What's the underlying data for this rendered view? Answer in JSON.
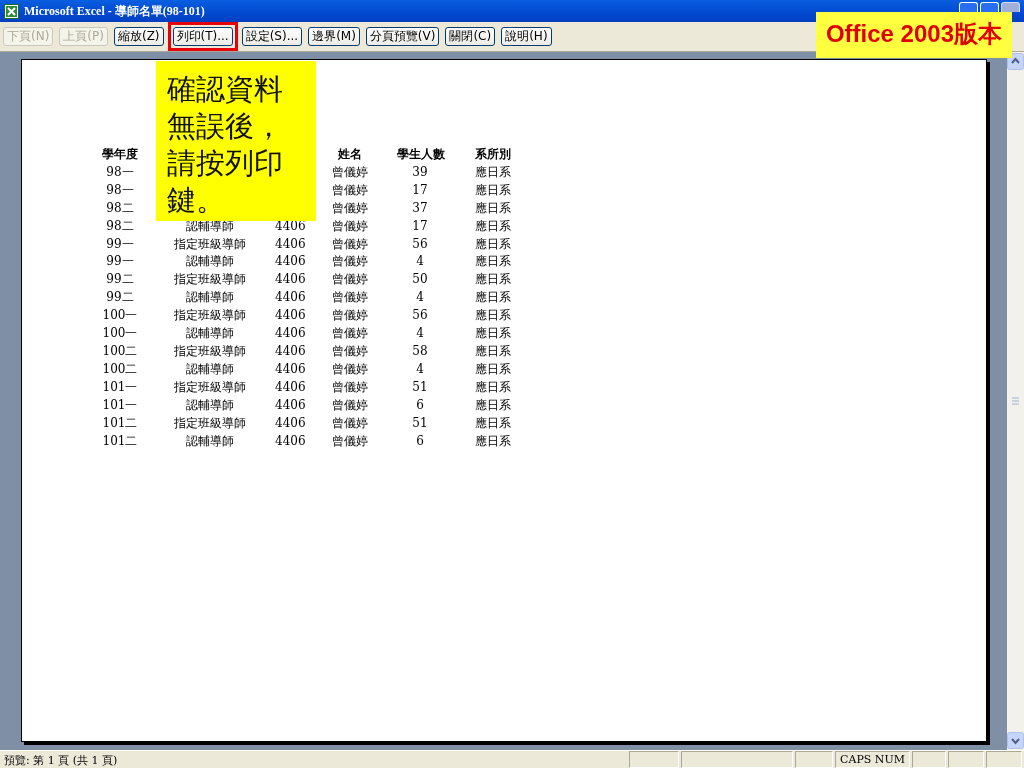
{
  "window": {
    "title": "Microsoft Excel - 導師名單(98-101)"
  },
  "version_label": "Office 2003版本",
  "toolbar": [
    {
      "label": "下頁(N)",
      "disabled": true,
      "highlighted": false
    },
    {
      "label": "上頁(P)",
      "disabled": true,
      "highlighted": false
    },
    {
      "label": "縮放(Z)",
      "disabled": false,
      "highlighted": false
    },
    {
      "label": "列印(T)...",
      "disabled": false,
      "highlighted": true
    },
    {
      "label": "設定(S)...",
      "disabled": false,
      "highlighted": false
    },
    {
      "label": "邊界(M)",
      "disabled": false,
      "highlighted": false
    },
    {
      "label": "分頁預覽(V)",
      "disabled": false,
      "highlighted": false
    },
    {
      "label": "關閉(C)",
      "disabled": false,
      "highlighted": false
    },
    {
      "label": "說明(H)",
      "disabled": false,
      "highlighted": false
    }
  ],
  "callout": "確認資料無誤後，請按列印鍵。",
  "table": {
    "columns": {
      "year": "學年度",
      "name": "姓名",
      "students": "學生人數",
      "dept": "系所別"
    },
    "rows": [
      {
        "year": "98一",
        "name": "曾儀婷",
        "students": "39",
        "dept": "應日系"
      },
      {
        "year": "98一",
        "name": "曾儀婷",
        "students": "17",
        "dept": "應日系"
      },
      {
        "year": "98二",
        "name": "曾儀婷",
        "students": "37",
        "dept": "應日系"
      },
      {
        "year": "98二",
        "role": "認輔導師",
        "ext": "4406",
        "name": "曾儀婷",
        "students": "17",
        "dept": "應日系"
      },
      {
        "year": "99一",
        "role": "指定班級導師",
        "ext": "4406",
        "name": "曾儀婷",
        "students": "56",
        "dept": "應日系"
      },
      {
        "year": "99一",
        "role": "認輔導師",
        "ext": "4406",
        "name": "曾儀婷",
        "students": "4",
        "dept": "應日系"
      },
      {
        "year": "99二",
        "role": "指定班級導師",
        "ext": "4406",
        "name": "曾儀婷",
        "students": "50",
        "dept": "應日系"
      },
      {
        "year": "99二",
        "role": "認輔導師",
        "ext": "4406",
        "name": "曾儀婷",
        "students": "4",
        "dept": "應日系"
      },
      {
        "year": "100一",
        "role": "指定班級導師",
        "ext": "4406",
        "name": "曾儀婷",
        "students": "56",
        "dept": "應日系"
      },
      {
        "year": "100一",
        "role": "認輔導師",
        "ext": "4406",
        "name": "曾儀婷",
        "students": "4",
        "dept": "應日系"
      },
      {
        "year": "100二",
        "role": "指定班級導師",
        "ext": "4406",
        "name": "曾儀婷",
        "students": "58",
        "dept": "應日系"
      },
      {
        "year": "100二",
        "role": "認輔導師",
        "ext": "4406",
        "name": "曾儀婷",
        "students": "4",
        "dept": "應日系"
      },
      {
        "year": "101一",
        "role": "指定班級導師",
        "ext": "4406",
        "name": "曾儀婷",
        "students": "51",
        "dept": "應日系"
      },
      {
        "year": "101一",
        "role": "認輔導師",
        "ext": "4406",
        "name": "曾儀婷",
        "students": "6",
        "dept": "應日系"
      },
      {
        "year": "101二",
        "role": "指定班級導師",
        "ext": "4406",
        "name": "曾儀婷",
        "students": "51",
        "dept": "應日系"
      },
      {
        "year": "101二",
        "role": "認輔導師",
        "ext": "4406",
        "name": "曾儀婷",
        "students": "6",
        "dept": "應日系"
      }
    ]
  },
  "status_bar": {
    "text": "預覽: 第 1 頁 (共 1 頁)",
    "indicators": "CAPS NUM"
  }
}
